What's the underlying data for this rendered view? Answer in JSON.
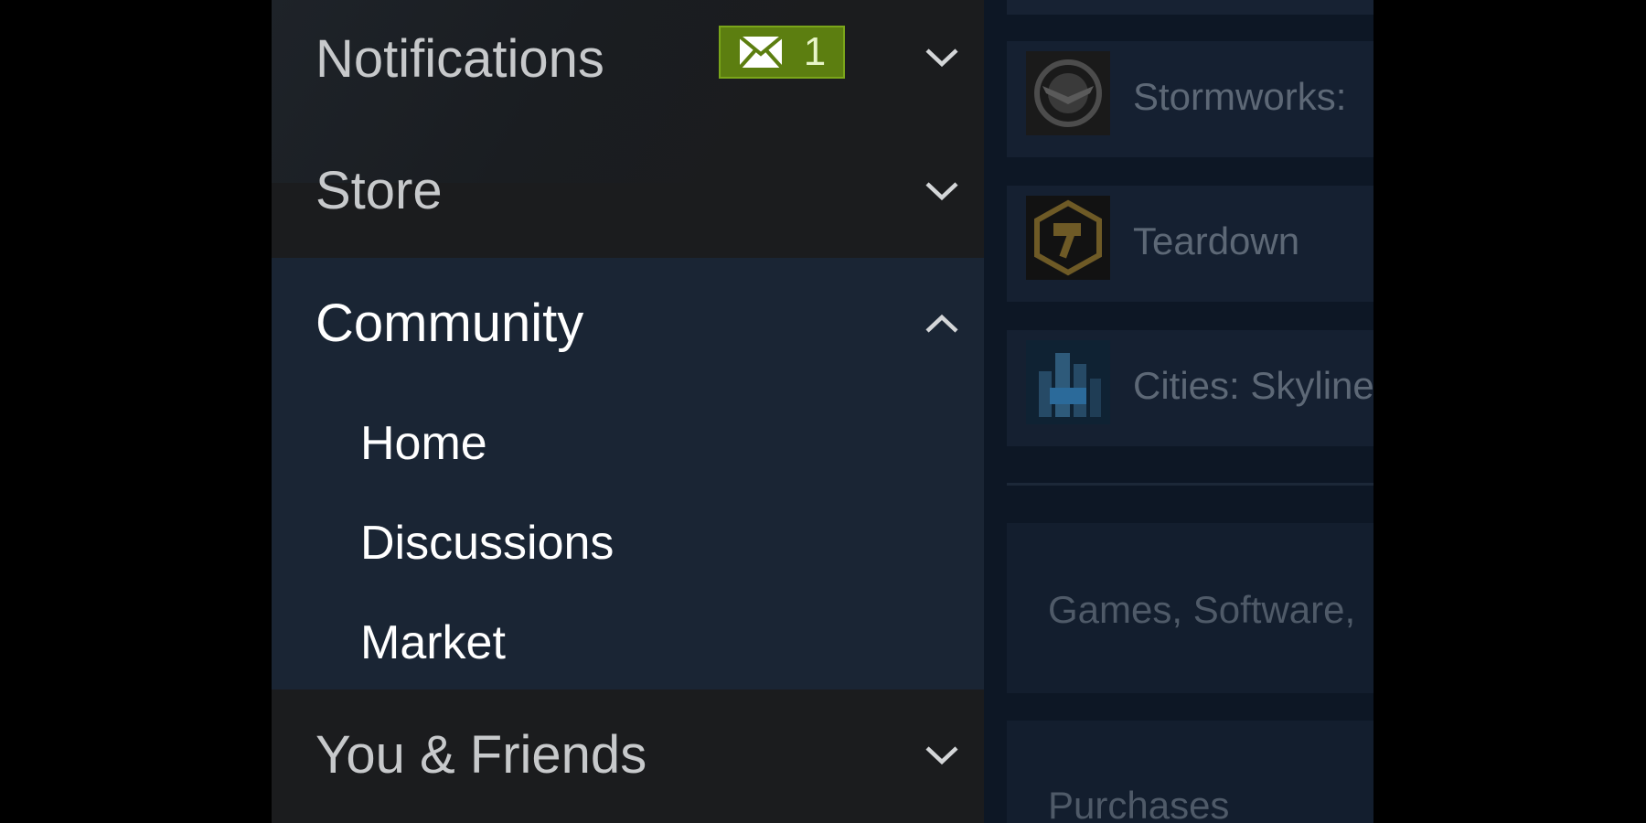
{
  "drawer": {
    "notifications": {
      "label": "Notifications",
      "badge_count": "1",
      "badge_icon": "envelope-icon",
      "chevron": "chevron-down-icon"
    },
    "store": {
      "label": "Store",
      "chevron": "chevron-down-icon"
    },
    "community": {
      "label": "Community",
      "chevron": "chevron-up-icon",
      "expanded": true,
      "items": [
        {
          "label": "Home"
        },
        {
          "label": "Discussions"
        },
        {
          "label": "Market"
        }
      ]
    },
    "you_friends": {
      "label": "You & Friends",
      "chevron": "chevron-down-icon"
    }
  },
  "background": {
    "games": [
      {
        "title": "Stormworks:",
        "icon": "stormworks-logo"
      },
      {
        "title": "Teardown",
        "icon": "teardown-logo"
      },
      {
        "title": "Cities: Skyline",
        "icon": "cities-skylines-logo"
      }
    ],
    "sections": [
      {
        "text": "Games, Software,"
      },
      {
        "text": "Purchases"
      }
    ]
  },
  "colors": {
    "drawer_bg": "#1b1c1e",
    "community_bg": "#1a2534",
    "badge_green": "#5c7e10",
    "text_muted": "#c7c9cb",
    "text_active": "#ffffff"
  }
}
